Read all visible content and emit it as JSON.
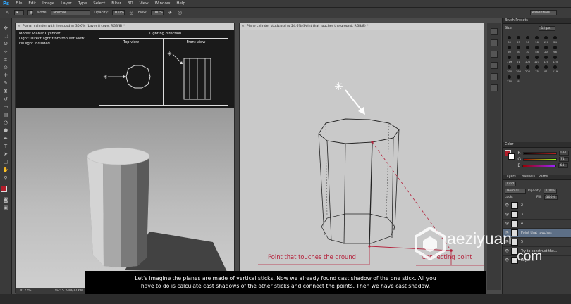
{
  "menubar": {
    "logo": "Ps",
    "items": [
      "File",
      "Edit",
      "Image",
      "Layer",
      "Type",
      "Select",
      "Filter",
      "3D",
      "View",
      "Window",
      "Help"
    ]
  },
  "options": {
    "mode_label": "Mode:",
    "mode_value": "Normal",
    "opacity_label": "Opacity:",
    "opacity_value": "100%",
    "flow_label": "Flow:",
    "flow_value": "100%",
    "workspace_value": "essentials"
  },
  "doc_left": {
    "tab_title": "Planar cylinder with lines.psd @ 30.6% (Layer 8 copy, RGB/8) *",
    "status_zoom": "30.77%",
    "status_doc": "Doc: 5.24M/27.6M",
    "info": {
      "model": "Model: Planar Cylinder",
      "light": "Light: Direct light from top left view",
      "fill": "Fill light included",
      "lighting_title": "Lighting direction",
      "top_view": "Top view",
      "front_view": "Front view"
    }
  },
  "doc_right": {
    "tab_title": "Plane cylinder study.psd @ 24.6% (Point that touches the ground, RGB/8) *",
    "status_zoom": "24.6%",
    "status_doc": "Doc: 27.2M/266M",
    "annot_ground": "Point that touches the ground",
    "annot_connect": "Connecting point"
  },
  "brush_presets": {
    "tab": "Brush Presets",
    "size_label": "Size:",
    "size_value": "12 px",
    "brushes": [
      "30",
      "25",
      "50",
      "16",
      "120",
      "24",
      "60",
      "8",
      "30",
      "58",
      "20",
      "96",
      "119",
      "21",
      "100",
      "121",
      "120",
      "125",
      "190",
      "195",
      "200",
      "75",
      "91",
      "119",
      "130",
      "8"
    ]
  },
  "color_panel": {
    "tab": "Color",
    "sliders": [
      {
        "label": "R",
        "value": "144"
      },
      {
        "label": "G",
        "value": "71"
      },
      {
        "label": "B",
        "value": "64"
      }
    ]
  },
  "layers_panel": {
    "tabs": [
      "Layers",
      "Channels",
      "Paths"
    ],
    "kind_label": "Kind",
    "blend_mode": "Normal",
    "opacity_label": "Opacity:",
    "opacity_value": "100%",
    "lock_label": "Lock:",
    "fill_label": "Fill:",
    "fill_value": "100%",
    "layers": [
      {
        "name": "2"
      },
      {
        "name": "3"
      },
      {
        "name": "4"
      },
      {
        "name": "Point that touches"
      },
      {
        "name": "5"
      },
      {
        "name": "Try to construct the..."
      },
      {
        "name": "Layer 6"
      }
    ]
  },
  "watermark": {
    "text": "aeziyuan",
    "suffix": ".com"
  },
  "subtitle": {
    "line1": "Let's imagine the planes are made of vertical sticks. Now we already found cast shadow of the one stick. All you",
    "line2": "have to do is calculate cast shadows of the other sticks and connect the points. Then we have cast shadow."
  },
  "colors": {
    "fg_swatch": "#b01d2a",
    "annotation_red": "#c0213a"
  }
}
